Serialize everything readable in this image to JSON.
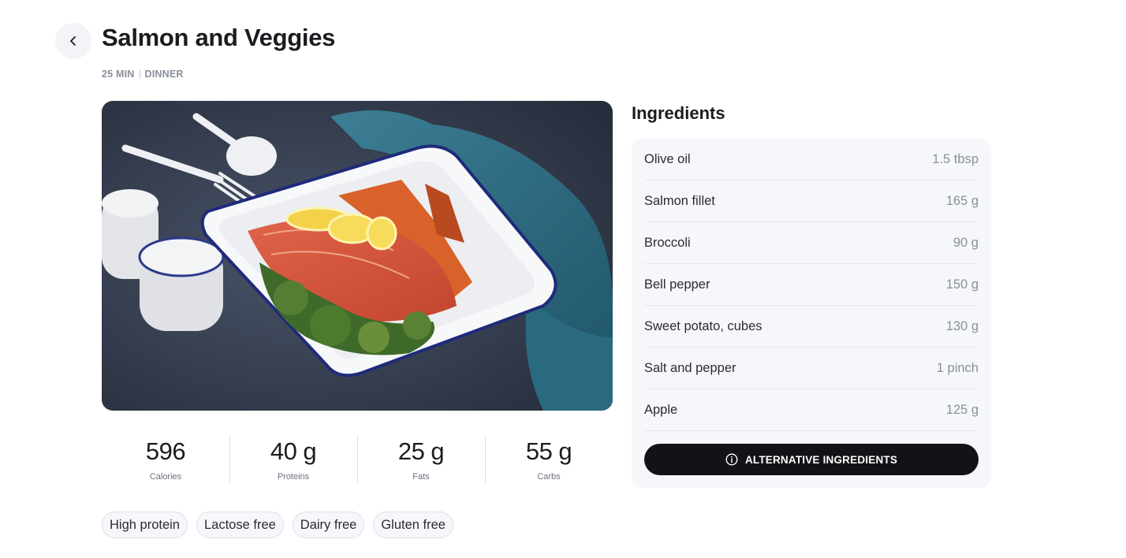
{
  "recipe": {
    "title": "Salmon and Veggies",
    "time": "25 MIN",
    "meal": "DINNER",
    "photo_icon": "salmon-dish-photo"
  },
  "nutrition": [
    {
      "value": "596",
      "label": "Calories"
    },
    {
      "value": "40 g",
      "label": "Proteins"
    },
    {
      "value": "25 g",
      "label": "Fats"
    },
    {
      "value": "55 g",
      "label": "Carbs"
    }
  ],
  "tags": [
    "High protein",
    "Lactose free",
    "Dairy free",
    "Gluten free"
  ],
  "ingredients": {
    "heading": "Ingredients",
    "items": [
      {
        "name": "Olive oil",
        "qty": "1.5 tbsp"
      },
      {
        "name": "Salmon fillet",
        "qty": "165 g"
      },
      {
        "name": "Broccoli",
        "qty": "90 g"
      },
      {
        "name": "Bell pepper",
        "qty": "150 g"
      },
      {
        "name": "Sweet potato, cubes",
        "qty": "130 g"
      },
      {
        "name": "Salt and pepper",
        "qty": "1 pinch"
      },
      {
        "name": "Apple",
        "qty": "125 g"
      }
    ],
    "alt_button": "ALTERNATIVE INGREDIENTS"
  },
  "icons": {
    "back": "chevron-left-icon",
    "info": "info-icon"
  },
  "colors": {
    "button_bg": "#121317",
    "panel_bg": "#f6f7fb",
    "muted_text": "#8a8f9c"
  }
}
